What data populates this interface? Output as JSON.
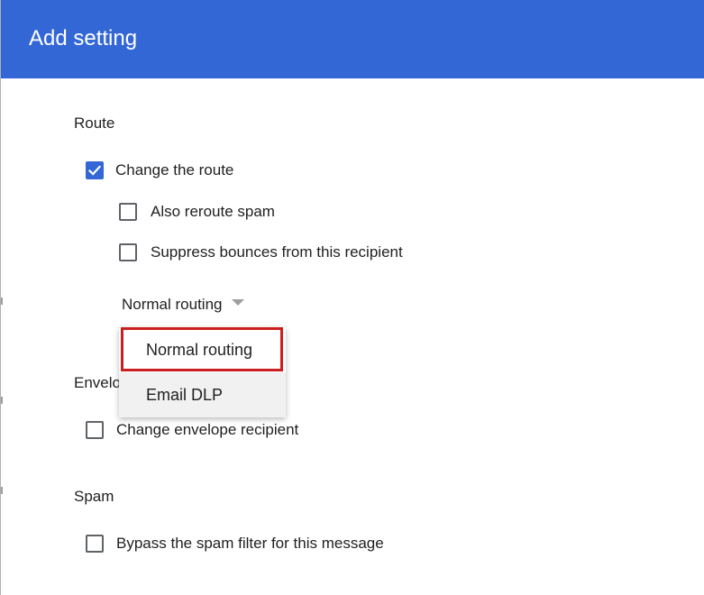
{
  "dialog": {
    "title": "Add setting"
  },
  "route": {
    "title": "Route",
    "change_route": {
      "label": "Change the route",
      "checked": true
    },
    "also_reroute_spam": {
      "label": "Also reroute spam",
      "checked": false
    },
    "suppress_bounces": {
      "label": "Suppress bounces from this recipient",
      "checked": false
    },
    "routing_select": {
      "value": "Normal routing",
      "options": [
        "Normal routing",
        "Email DLP"
      ],
      "highlighted_option": "Normal routing"
    }
  },
  "envelope": {
    "title": "Envelo",
    "change_recipient": {
      "label": "Change envelope recipient",
      "checked": false
    }
  },
  "spam": {
    "title": "Spam",
    "bypass_filter": {
      "label": "Bypass the spam filter for this message",
      "checked": false
    }
  },
  "colors": {
    "header_bg": "#3367d6",
    "checkbox_checked": "#3367d6",
    "highlight_border": "#cc1f1f"
  },
  "icons": {
    "checkmark": "check-icon",
    "dropdown_arrow": "dropdown-arrow-icon"
  }
}
